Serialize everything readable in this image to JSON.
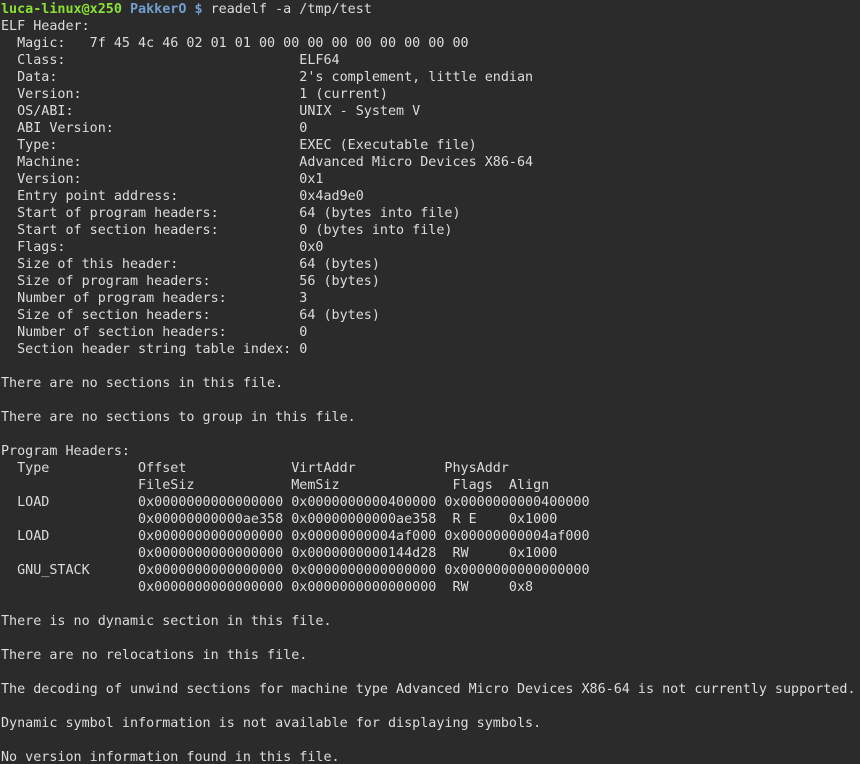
{
  "prompt": {
    "user_host": "luca-linux@x250",
    "cwd": "PakkerO",
    "symbol": "$",
    "command": "readelf -a /tmp/test"
  },
  "colors": {
    "background": "#2b2b2b",
    "text": "#dcdcdc",
    "user_host": "#8ae234",
    "path": "#729fcf"
  },
  "output_lines": [
    "ELF Header:",
    "  Magic:   7f 45 4c 46 02 01 01 00 00 00 00 00 00 00 00 00",
    "  Class:                             ELF64",
    "  Data:                              2's complement, little endian",
    "  Version:                           1 (current)",
    "  OS/ABI:                            UNIX - System V",
    "  ABI Version:                       0",
    "  Type:                              EXEC (Executable file)",
    "  Machine:                           Advanced Micro Devices X86-64",
    "  Version:                           0x1",
    "  Entry point address:               0x4ad9e0",
    "  Start of program headers:          64 (bytes into file)",
    "  Start of section headers:          0 (bytes into file)",
    "  Flags:                             0x0",
    "  Size of this header:               64 (bytes)",
    "  Size of program headers:           56 (bytes)",
    "  Number of program headers:         3",
    "  Size of section headers:           64 (bytes)",
    "  Number of section headers:         0",
    "  Section header string table index: 0",
    "",
    "There are no sections in this file.",
    "",
    "There are no sections to group in this file.",
    "",
    "Program Headers:",
    "  Type           Offset             VirtAddr           PhysAddr",
    "                 FileSiz            MemSiz              Flags  Align",
    "  LOAD           0x0000000000000000 0x0000000000400000 0x0000000000400000",
    "                 0x00000000000ae358 0x00000000000ae358  R E    0x1000",
    "  LOAD           0x0000000000000000 0x00000000004af000 0x00000000004af000",
    "                 0x0000000000000000 0x0000000000144d28  RW     0x1000",
    "  GNU_STACK      0x0000000000000000 0x0000000000000000 0x0000000000000000",
    "                 0x0000000000000000 0x0000000000000000  RW     0x8",
    "",
    "There is no dynamic section in this file.",
    "",
    "There are no relocations in this file.",
    "",
    "The decoding of unwind sections for machine type Advanced Micro Devices X86-64 is not currently supported.",
    "",
    "Dynamic symbol information is not available for displaying symbols.",
    "",
    "No version information found in this file."
  ]
}
